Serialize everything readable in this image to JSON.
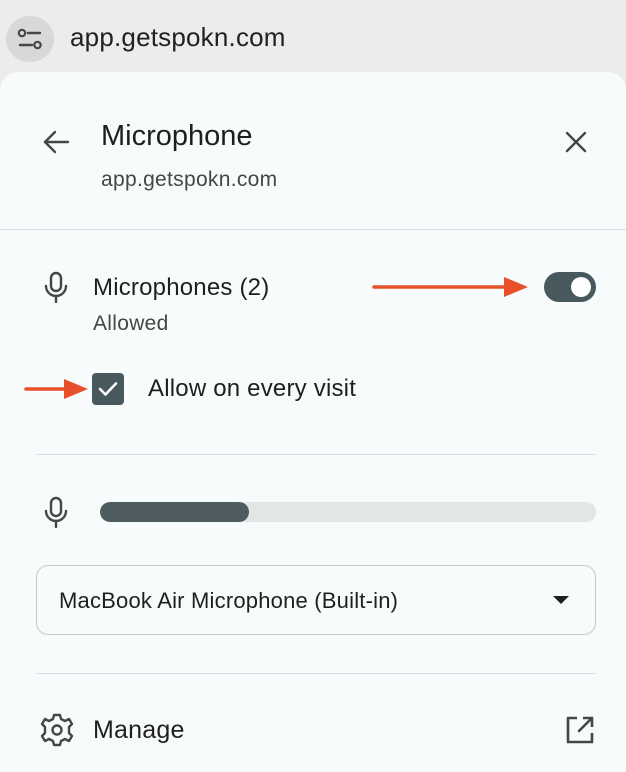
{
  "address_bar": {
    "url": "app.getspokn.com",
    "site_info_icon": "tune-icon"
  },
  "panel": {
    "title": "Microphone",
    "subtitle": "app.getspokn.com",
    "back_icon": "arrow-back-icon",
    "close_icon": "close-icon"
  },
  "permission": {
    "label": "Microphones (2)",
    "status": "Allowed",
    "toggle_on": true,
    "icon": "microphone-icon"
  },
  "remember": {
    "label": "Allow on every visit",
    "checked": true
  },
  "level": {
    "fraction": 0.3,
    "icon": "microphone-icon"
  },
  "device_select": {
    "selected": "MacBook Air Microphone (Built-in)"
  },
  "manage": {
    "label": "Manage",
    "icon": "gear-icon",
    "trailing_icon": "open-in-new-icon"
  },
  "colors": {
    "accent": "#48595d",
    "annotation_arrow": "#e8502b",
    "panel_bg": "#f8fbfb"
  }
}
